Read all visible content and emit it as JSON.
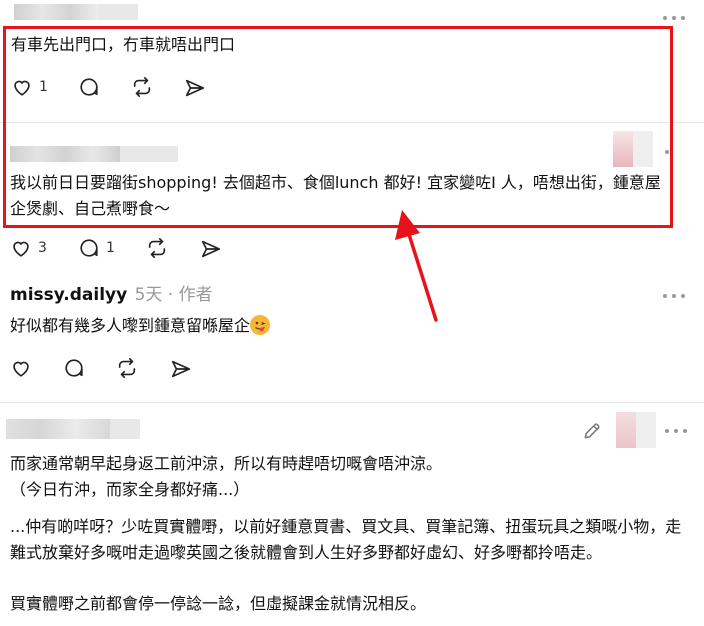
{
  "post1": {
    "text": "有車先出門口，冇車就唔出門口",
    "like_count": "1"
  },
  "post2": {
    "text": "我以前日日要蹓街shopping! 去個超市、食個lunch 都好! 宜家變咗I 人，唔想出街，鍾意屋企煲劇、自己煮嘢食～",
    "like_count": "3",
    "reply_count": "1"
  },
  "post3": {
    "username": "missy.dailyy",
    "time": "5天",
    "separator": "·",
    "author_badge": "作者",
    "text": "好似都有幾多人嚟到鍾意留喺屋企",
    "emoji": "😜"
  },
  "post4": {
    "line1": "而家通常朝早起身返工前沖涼，所以有時趕唔切嘅會唔沖涼。",
    "line2": "（今日冇沖，而家全身都好痛...）",
    "para2": "...仲有啲咩呀？少咗買實體嘢，以前好鍾意買書、買文具、買筆記簿、扭蛋玩具之類嘅小物，走難式放棄好多嘅咁走過嚟英國之後就體會到人生好多野都好虛幻、好多嘢都拎唔走。",
    "line_last": "買實體嘢之前都會停一停諗一諗，但虛擬課金就情況相反。"
  },
  "colors": {
    "highlight": "#e8121b",
    "arrow": "#e8121b",
    "muted": "#999999",
    "icon": "#222222"
  },
  "icons": [
    "heart-icon",
    "comment-icon",
    "repost-icon",
    "share-icon",
    "more-icon",
    "edit-icon"
  ]
}
